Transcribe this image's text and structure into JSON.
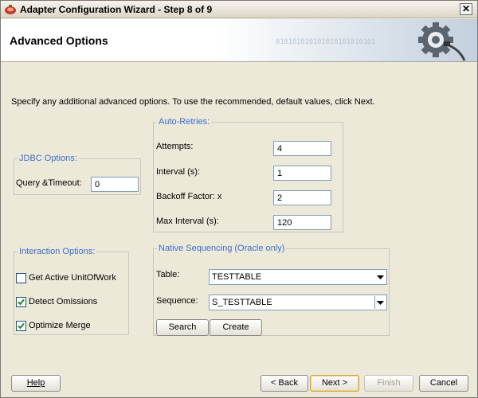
{
  "window": {
    "title": "Adapter Configuration Wizard - Step 8 of 9",
    "close_glyph": "✕"
  },
  "banner": {
    "title": "Advanced Options",
    "binary_text": "010101010101010101010101",
    "icon": "gear-icon"
  },
  "intro": "Specify any additional advanced options.  To use the recommended, default values, click Next.",
  "jdbc": {
    "legend": "JDBC Options:",
    "query_timeout_label": "Query &Timeout:",
    "query_timeout_value": "0"
  },
  "retries": {
    "legend": "Auto-Retries:",
    "attempts_label": "Attempts:",
    "attempts_value": "4",
    "interval_label": "Interval (s):",
    "interval_value": "1",
    "backoff_label": "Backoff Factor: x",
    "backoff_value": "2",
    "max_interval_label": "Max Interval (s):",
    "max_interval_value": "120"
  },
  "interaction": {
    "legend": "Interaction Options:",
    "items": [
      {
        "label": "Get Active UnitOfWork",
        "checked": false
      },
      {
        "label": "Detect Omissions",
        "checked": true
      },
      {
        "label": "Optimize Merge",
        "checked": true
      }
    ]
  },
  "sequencing": {
    "legend": "Native Sequencing (Oracle only)",
    "table_label": "Table:",
    "table_value": "TESTTABLE",
    "sequence_label": "Sequence:",
    "sequence_value": "S_TESTTABLE",
    "search_button": "Search",
    "create_button": "Create"
  },
  "footer": {
    "help": "Help",
    "back": "< Back",
    "next": "Next >",
    "finish": "Finish",
    "cancel": "Cancel"
  },
  "colors": {
    "legend": "#3b6ed0",
    "check": "#1f8a1f",
    "dialog_bg": "#ece9d8"
  }
}
